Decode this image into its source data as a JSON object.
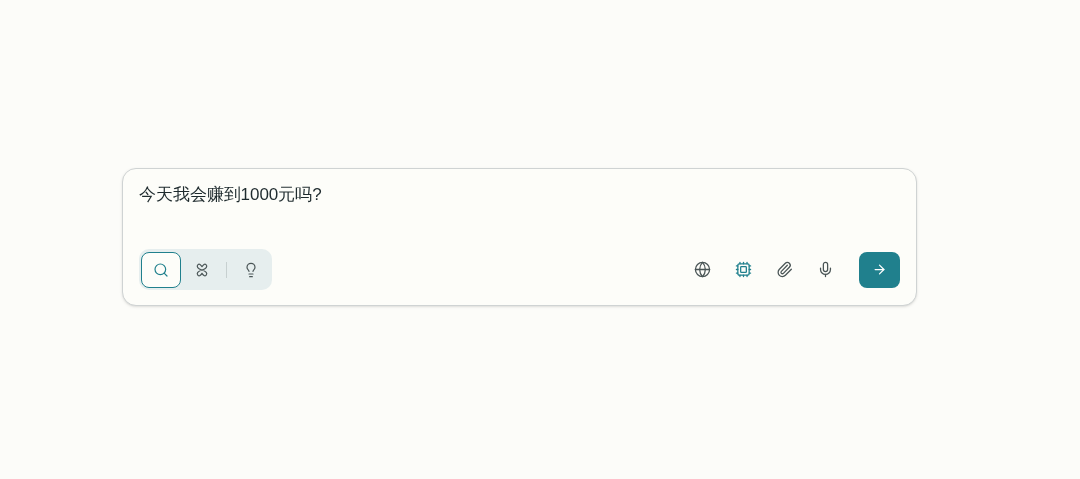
{
  "query": {
    "value": "今天我会赚到1000元吗?"
  },
  "modes": [
    {
      "kind": "search",
      "selected": true
    },
    {
      "kind": "reasoning",
      "selected": false
    },
    {
      "kind": "ideas",
      "selected": false
    }
  ],
  "tools": [
    {
      "kind": "web",
      "on": false
    },
    {
      "kind": "model",
      "on": true
    },
    {
      "kind": "attach",
      "on": false
    },
    {
      "kind": "voice",
      "on": false
    }
  ]
}
